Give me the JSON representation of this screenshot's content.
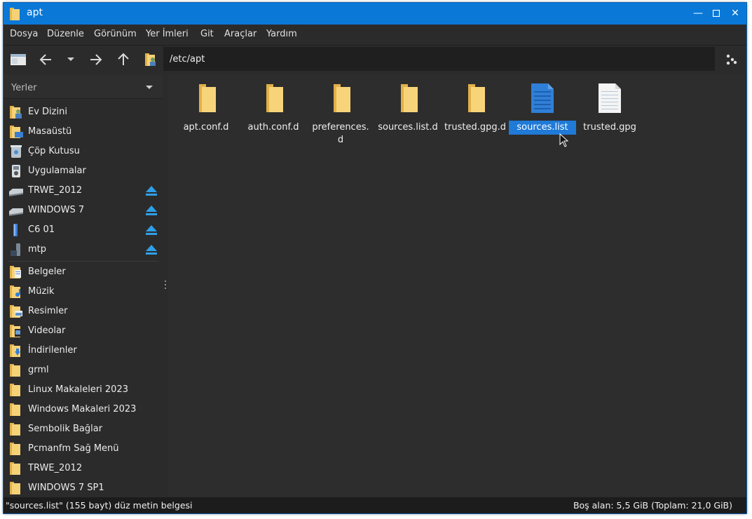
{
  "window": {
    "title": "apt"
  },
  "menu": [
    "Dosya",
    "Düzenle",
    "Görünüm",
    "Yer İmleri",
    "Git",
    "Araçlar",
    "Yardım"
  ],
  "toolbar": {
    "path": "/etc/apt"
  },
  "sidebar": {
    "header": "Yerler",
    "places": [
      {
        "label": "Ev Dizini",
        "icon": "home-folder-icon"
      },
      {
        "label": "Masaüstü",
        "icon": "desktop-folder-icon"
      },
      {
        "label": "Çöp Kutusu",
        "icon": "trash-icon"
      },
      {
        "label": "Uygulamalar",
        "icon": "applications-icon"
      }
    ],
    "devices": [
      {
        "label": "TRWE_2012",
        "icon": "drive-icon"
      },
      {
        "label": "WINDOWS 7",
        "icon": "drive-icon"
      },
      {
        "label": "C6 01",
        "icon": "usb-drive-icon"
      },
      {
        "label": "mtp",
        "icon": "phone-icon"
      }
    ],
    "bookmarks": [
      {
        "label": "Belgeler",
        "icon": "documents-folder-icon"
      },
      {
        "label": "Müzik",
        "icon": "music-folder-icon"
      },
      {
        "label": "Resimler",
        "icon": "pictures-folder-icon"
      },
      {
        "label": "Videolar",
        "icon": "videos-folder-icon"
      },
      {
        "label": "İndirilenler",
        "icon": "downloads-folder-icon"
      },
      {
        "label": "grml",
        "icon": "folder-icon"
      },
      {
        "label": "Linux Makaleleri 2023",
        "icon": "folder-icon"
      },
      {
        "label": "Windows Makaleri 2023",
        "icon": "folder-icon"
      },
      {
        "label": "Sembolik Bağlar",
        "icon": "folder-icon"
      },
      {
        "label": "Pcmanfm Sağ Menü",
        "icon": "folder-icon"
      },
      {
        "label": "TRWE_2012",
        "icon": "folder-icon"
      },
      {
        "label": "WINDOWS 7 SP1",
        "icon": "folder-icon"
      }
    ]
  },
  "files": [
    {
      "name": "apt.conf.d",
      "type": "folder",
      "selected": false
    },
    {
      "name": "auth.conf.d",
      "type": "folder",
      "selected": false
    },
    {
      "name": "preferences.\nd",
      "type": "folder",
      "selected": false
    },
    {
      "name": "sources.list.d",
      "type": "folder",
      "selected": false
    },
    {
      "name": "trusted.gpg.d",
      "type": "folder",
      "selected": false
    },
    {
      "name": "sources.list",
      "type": "text-file-blue",
      "selected": true
    },
    {
      "name": "trusted.gpg",
      "type": "text-file",
      "selected": false
    }
  ],
  "status": {
    "left": "\"sources.list\" (155 bayt) düz metin belgesi",
    "right": "Boş alan: 5,5 GiB (Toplam: 21,0 GiB)"
  },
  "colors": {
    "titlebar": "#0a78d7",
    "selection": "#1f7ad8",
    "folder": "#f4c95d",
    "eject": "#2f9fe8"
  }
}
